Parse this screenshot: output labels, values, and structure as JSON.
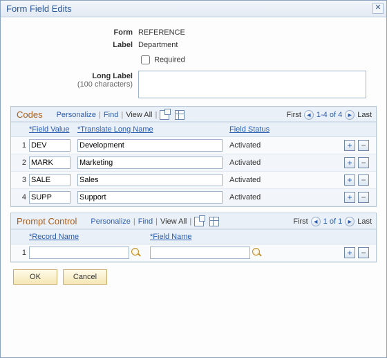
{
  "window": {
    "title": "Form Field Edits"
  },
  "form": {
    "form_label": "Form",
    "form_value": "REFERENCE",
    "label_label": "Label",
    "label_value": "Department",
    "required_label": "Required",
    "required_checked": false,
    "longlabel_label": "Long Label",
    "longlabel_hint": "(100 characters)",
    "longlabel_value": ""
  },
  "codes": {
    "title": "Codes",
    "toolbar": {
      "personalize": "Personalize",
      "find": "Find",
      "view_all": "View All"
    },
    "paging": {
      "first": "First",
      "range": "1-4 of 4",
      "last": "Last"
    },
    "columns": {
      "field_value": "*Field Value",
      "translate_long_name": "*Translate Long Name",
      "field_status": "Field Status"
    },
    "rows": [
      {
        "n": "1",
        "fv": "DEV",
        "tln": "Development",
        "fs": "Activated"
      },
      {
        "n": "2",
        "fv": "MARK",
        "tln": "Marketing",
        "fs": "Activated"
      },
      {
        "n": "3",
        "fv": "SALE",
        "tln": "Sales",
        "fs": "Activated"
      },
      {
        "n": "4",
        "fv": "SUPP",
        "tln": "Support",
        "fs": "Activated"
      }
    ]
  },
  "prompt": {
    "title": "Prompt Control",
    "toolbar": {
      "personalize": "Personalize",
      "find": "Find",
      "view_all": "View All"
    },
    "paging": {
      "first": "First",
      "range": "1 of 1",
      "last": "Last"
    },
    "columns": {
      "record_name": "*Record Name",
      "field_name": "*Field Name"
    },
    "rows": [
      {
        "n": "1",
        "rn": "",
        "fn": ""
      }
    ]
  },
  "buttons": {
    "ok": "OK",
    "cancel": "Cancel"
  },
  "glyphs": {
    "plus": "+",
    "minus": "−",
    "prev": "◄",
    "next": "►",
    "close": "✕"
  }
}
